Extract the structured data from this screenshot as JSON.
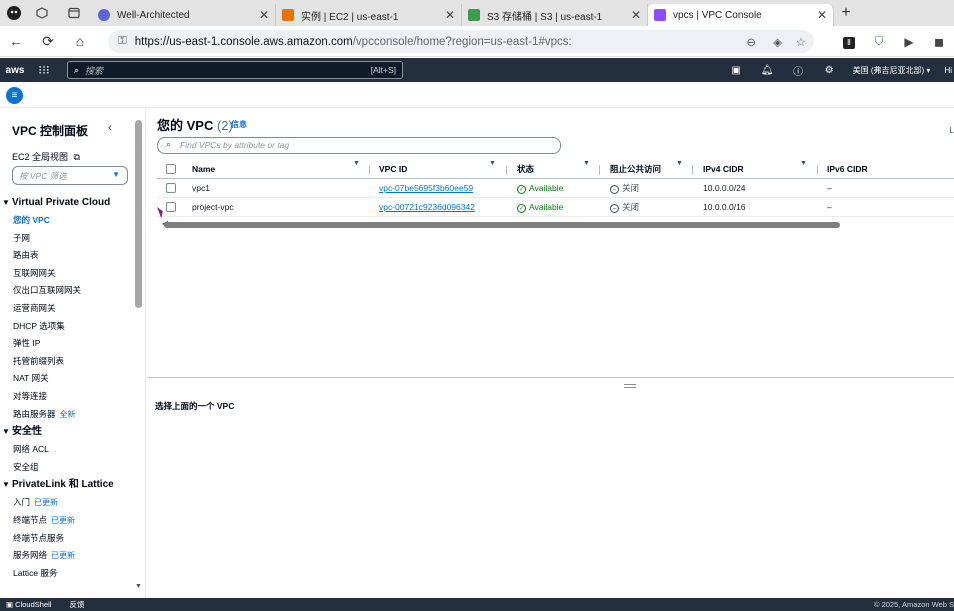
{
  "browser": {
    "tabs": [
      {
        "title": "Well-Architected",
        "color": "#5a67d8",
        "active": false
      },
      {
        "title": "实例 | EC2 | us-east-1",
        "color": "#ed7100",
        "active": false
      },
      {
        "title": "S3 存储桶 | S3 | us-east-1",
        "color": "#3b9c4a",
        "active": false
      },
      {
        "title": "vpcs | VPC Console",
        "color": "#8c4fff",
        "active": true
      }
    ],
    "url_host": "https://us-east-1.console.aws.amazon.com",
    "url_rest": "/vpcconsole/home?region=us-east-1#vpcs:"
  },
  "aws": {
    "logo": "aws",
    "search_placeholder": "搜索",
    "search_shortcut": "[Alt+S]",
    "region": "美国 (弗吉尼亚北部) ▾",
    "account_stub": "Hi"
  },
  "sidebar": {
    "title": "VPC 控制面板",
    "global_view": "EC2 全局视图",
    "filter_placeholder": "按 VPC 筛选",
    "sections": [
      {
        "title": "Virtual Private Cloud",
        "items": [
          {
            "label": "您的 VPC",
            "active": true,
            "badge": ""
          },
          {
            "label": "子网",
            "badge": ""
          },
          {
            "label": "路由表",
            "badge": ""
          },
          {
            "label": "互联网网关",
            "badge": ""
          },
          {
            "label": "仅出口互联网网关",
            "badge": ""
          },
          {
            "label": "运营商网关",
            "badge": ""
          },
          {
            "label": "DHCP 选项集",
            "badge": ""
          },
          {
            "label": "弹性 IP",
            "badge": ""
          },
          {
            "label": "托管前缀列表",
            "badge": ""
          },
          {
            "label": "NAT 网关",
            "badge": ""
          },
          {
            "label": "对等连接",
            "badge": ""
          },
          {
            "label": "路由服务器",
            "badge": "全新"
          }
        ]
      },
      {
        "title": "安全性",
        "items": [
          {
            "label": "网络 ACL",
            "badge": ""
          },
          {
            "label": "安全组",
            "badge": ""
          }
        ]
      },
      {
        "title": "PrivateLink 和 Lattice",
        "items": [
          {
            "label": "入门",
            "badge": "已更新"
          },
          {
            "label": "终端节点",
            "badge": "已更新"
          },
          {
            "label": "终端节点服务",
            "badge": ""
          },
          {
            "label": "服务网络",
            "badge": "已更新"
          },
          {
            "label": "Lattice 服务",
            "badge": ""
          }
        ]
      }
    ]
  },
  "main": {
    "title": "您的 VPC",
    "count": "(2)",
    "info": "信息",
    "search_placeholder": "Find VPCs by attribute or tag",
    "right_edge": "L",
    "columns": [
      "Name",
      "VPC ID",
      "状态",
      "阻止公共访问",
      "IPv4 CIDR",
      "IPv6 CIDR"
    ],
    "rows": [
      {
        "name": "vpc1",
        "vpc_id": "vpc-07be5695f3b60ee59",
        "state": "Available",
        "block": "关闭",
        "ipv4": "10.0.0.0/24",
        "ipv6": "–"
      },
      {
        "name": "project-vpc",
        "vpc_id": "vpc-00721c9236d096342",
        "state": "Available",
        "block": "关闭",
        "ipv4": "10.0.0.0/16",
        "ipv6": "–"
      }
    ],
    "detail_message": "选择上面的一个 VPC"
  },
  "footer": {
    "cloudshell": "CloudShell",
    "feedback": "反馈",
    "copyright": "© 2025, Amazon Web S"
  }
}
